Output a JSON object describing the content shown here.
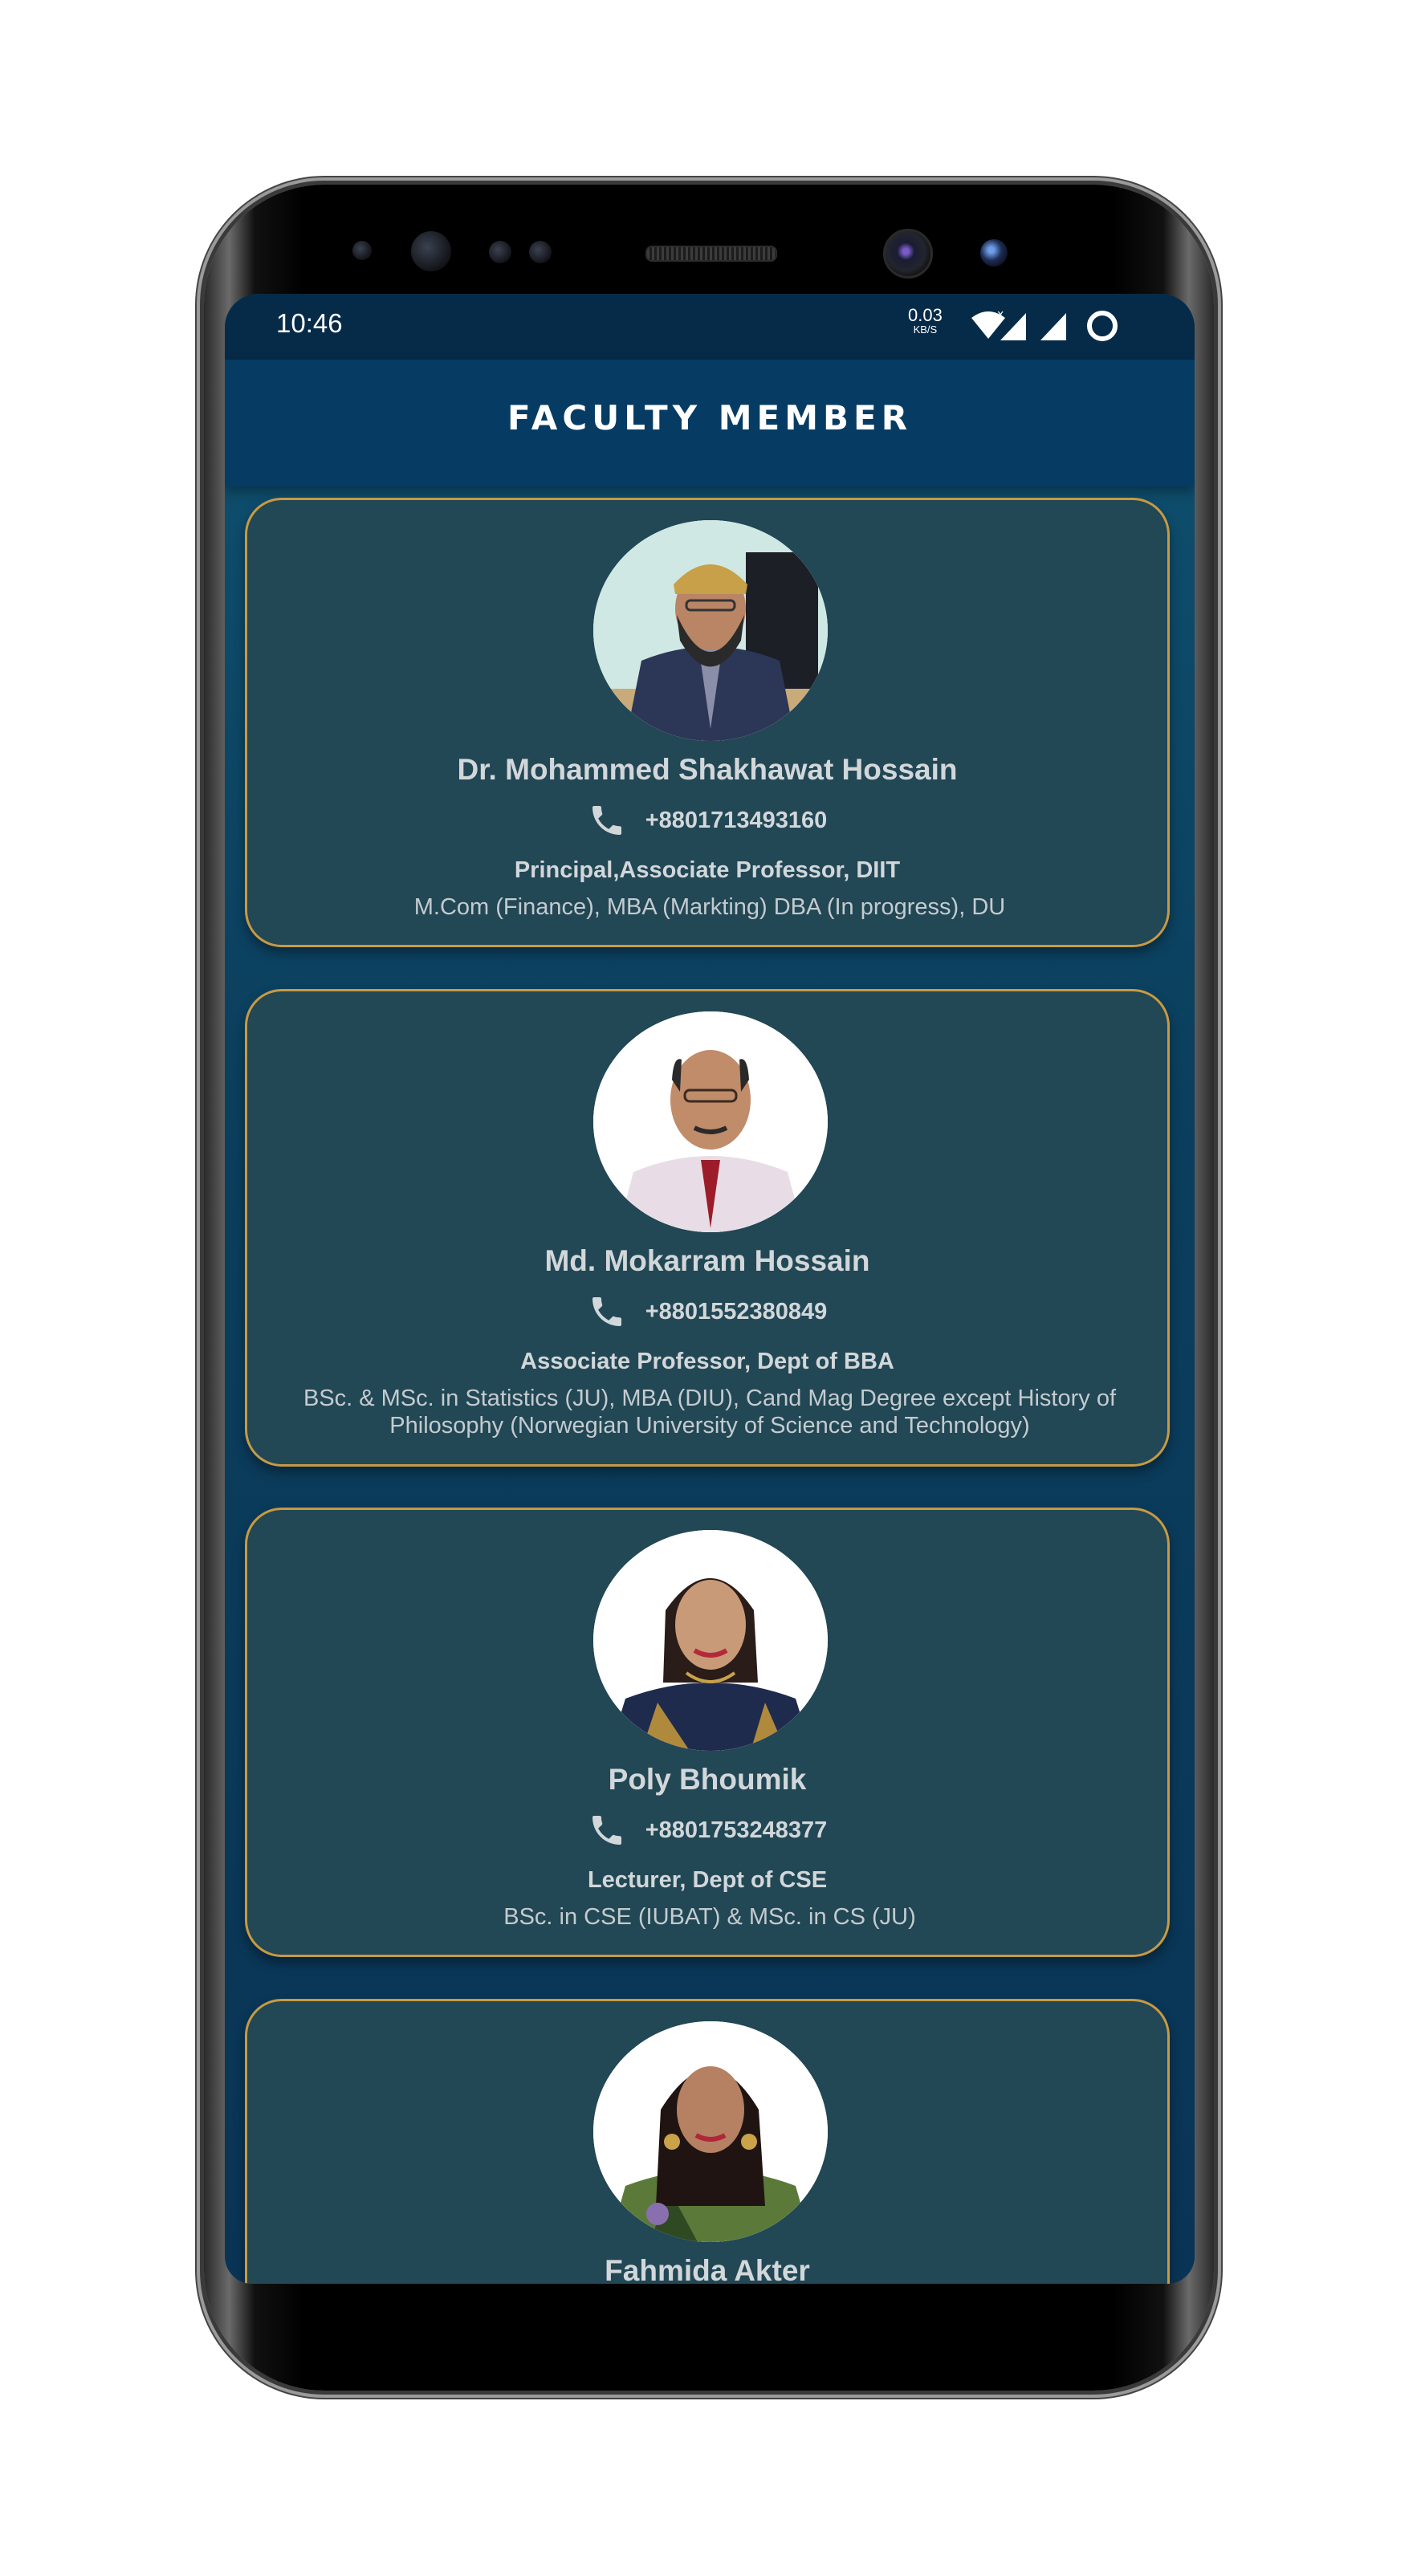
{
  "status_bar": {
    "time": "10:46",
    "net_speed_value": "0.03",
    "net_speed_unit": "KB/S",
    "icons": [
      "wifi-icon",
      "signal-icon",
      "signal-icon",
      "loading-ring-icon"
    ]
  },
  "app_bar": {
    "title": "FACULTY MEMBER"
  },
  "colors": {
    "card_border": "#c79a45",
    "card_bg": "#224755",
    "app_bar": "#063c63",
    "status_bar": "#062b49"
  },
  "faculty": [
    {
      "name": "Dr. Mohammed Shakhawat Hossain",
      "phone": "+8801713493160",
      "role": "Principal,Associate Professor, DIIT",
      "degree": "M.Com (Finance), MBA (Markting) DBA (In progress), DU"
    },
    {
      "name": "Md. Mokarram Hossain",
      "phone": "+8801552380849",
      "role": "Associate Professor, Dept of BBA",
      "degree": "BSc. & MSc. in Statistics (JU), MBA (DIU), Cand Mag Degree except History of Philosophy (Norwegian University of Science and Technology)"
    },
    {
      "name": "Poly Bhoumik",
      "phone": "+8801753248377",
      "role": "Lecturer, Dept of CSE",
      "degree": "BSc. in CSE (IUBAT) & MSc. in CS (JU)"
    },
    {
      "name": "Fahmida Akter"
    }
  ]
}
